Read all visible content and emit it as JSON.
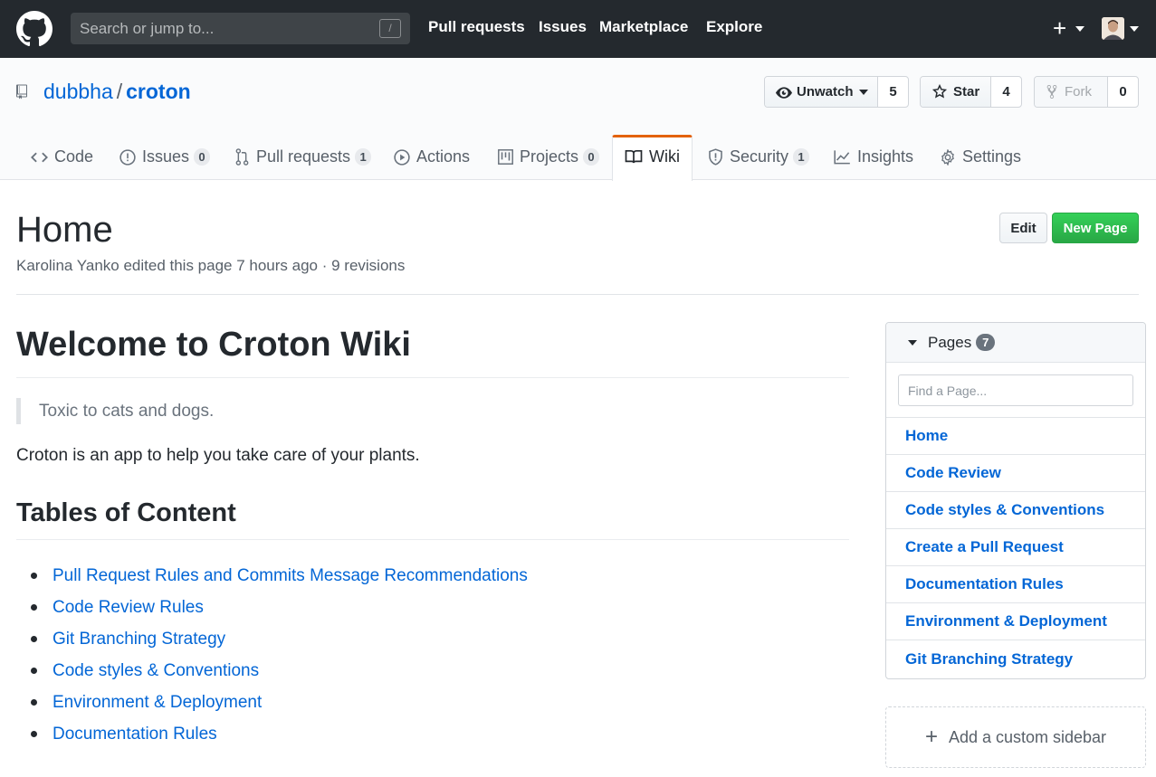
{
  "header": {
    "search_placeholder": "Search or jump to...",
    "search_key": "/",
    "nav": [
      "Pull requests",
      "Issues",
      "Marketplace",
      "Explore"
    ],
    "plus": "+"
  },
  "repo": {
    "owner": "dubbha",
    "separator": "/",
    "name": "croton",
    "watch": {
      "label": "Unwatch",
      "count": "5"
    },
    "star": {
      "label": "Star",
      "count": "4"
    },
    "fork": {
      "label": "Fork",
      "count": "0"
    }
  },
  "tabs": [
    {
      "label": "Code",
      "icon": "code-icon"
    },
    {
      "label": "Issues",
      "count": "0",
      "icon": "issue-icon"
    },
    {
      "label": "Pull requests",
      "count": "1",
      "icon": "pull-request-icon"
    },
    {
      "label": "Actions",
      "icon": "play-icon"
    },
    {
      "label": "Projects",
      "count": "0",
      "icon": "project-icon"
    },
    {
      "label": "Wiki",
      "icon": "book-icon",
      "active": true
    },
    {
      "label": "Security",
      "count": "1",
      "icon": "shield-icon"
    },
    {
      "label": "Insights",
      "icon": "graph-icon"
    },
    {
      "label": "Settings",
      "icon": "gear-icon"
    }
  ],
  "wiki": {
    "title": "Home",
    "meta": "Karolina Yanko edited this page 7 hours ago · 9 revisions",
    "edit_label": "Edit",
    "new_page_label": "New Page",
    "heading": "Welcome to Croton Wiki",
    "quote": "Toxic to cats and dogs.",
    "paragraph": "Croton is an app to help you take care of your plants.",
    "toc_heading": "Tables of Content",
    "toc": [
      "Pull Request Rules and Commits Message Recommendations",
      "Code Review Rules",
      "Git Branching Strategy",
      "Code styles & Conventions",
      "Environment & Deployment",
      "Documentation Rules"
    ]
  },
  "sidebar": {
    "pages_label": "Pages",
    "pages_count": "7",
    "find_placeholder": "Find a Page...",
    "pages": [
      "Home",
      "Code Review",
      "Code styles & Conventions",
      "Create a Pull Request",
      "Documentation Rules",
      "Environment & Deployment",
      "Git Branching Strategy"
    ],
    "custom_sidebar_label": "Add a custom sidebar"
  },
  "colors": {
    "header_bg": "#24292e",
    "link": "#0366d6",
    "active_tab": "#e36209",
    "new_page_green": "#28a745"
  }
}
